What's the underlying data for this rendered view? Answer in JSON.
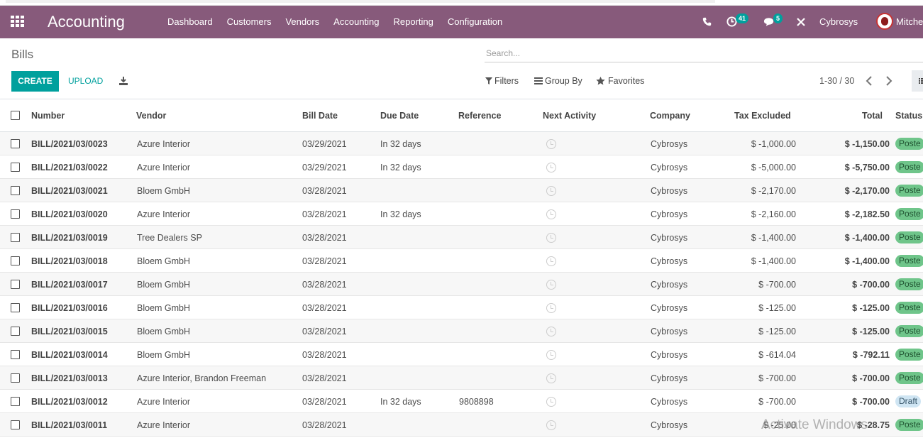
{
  "navbar": {
    "brand": "Accounting",
    "menu": [
      "Dashboard",
      "Customers",
      "Vendors",
      "Accounting",
      "Reporting",
      "Configuration"
    ],
    "activity_count": "41",
    "message_count": "5",
    "company": "Cybrosys",
    "user": "Mitche"
  },
  "page": {
    "title": "Bills",
    "search_placeholder": "Search...",
    "create_label": "CREATE",
    "upload_label": "UPLOAD",
    "filters_label": "Filters",
    "groupby_label": "Group By",
    "favorites_label": "Favorites",
    "pager": "1-30 / 30"
  },
  "table": {
    "columns": [
      "Number",
      "Vendor",
      "Bill Date",
      "Due Date",
      "Reference",
      "Next Activity",
      "Company",
      "Tax Excluded",
      "Total",
      "Status"
    ],
    "rows": [
      {
        "number": "BILL/2021/03/0023",
        "vendor": "Azure Interior",
        "bill_date": "03/29/2021",
        "due_date": "In 32 days",
        "reference": "",
        "company": "Cybrosys",
        "tax_excluded": "$ -1,000.00",
        "total": "$ -1,150.00",
        "status": "Poste",
        "status_type": "posted"
      },
      {
        "number": "BILL/2021/03/0022",
        "vendor": "Azure Interior",
        "bill_date": "03/29/2021",
        "due_date": "In 32 days",
        "reference": "",
        "company": "Cybrosys",
        "tax_excluded": "$ -5,000.00",
        "total": "$ -5,750.00",
        "status": "Poste",
        "status_type": "posted"
      },
      {
        "number": "BILL/2021/03/0021",
        "vendor": "Bloem GmbH",
        "bill_date": "03/28/2021",
        "due_date": "",
        "reference": "",
        "company": "Cybrosys",
        "tax_excluded": "$ -2,170.00",
        "total": "$ -2,170.00",
        "status": "Poste",
        "status_type": "posted"
      },
      {
        "number": "BILL/2021/03/0020",
        "vendor": "Azure Interior",
        "bill_date": "03/28/2021",
        "due_date": "In 32 days",
        "reference": "",
        "company": "Cybrosys",
        "tax_excluded": "$ -2,160.00",
        "total": "$ -2,182.50",
        "status": "Poste",
        "status_type": "posted"
      },
      {
        "number": "BILL/2021/03/0019",
        "vendor": "Tree Dealers SP",
        "bill_date": "03/28/2021",
        "due_date": "",
        "reference": "",
        "company": "Cybrosys",
        "tax_excluded": "$ -1,400.00",
        "total": "$ -1,400.00",
        "status": "Poste",
        "status_type": "posted"
      },
      {
        "number": "BILL/2021/03/0018",
        "vendor": "Bloem GmbH",
        "bill_date": "03/28/2021",
        "due_date": "",
        "reference": "",
        "company": "Cybrosys",
        "tax_excluded": "$ -1,400.00",
        "total": "$ -1,400.00",
        "status": "Poste",
        "status_type": "posted"
      },
      {
        "number": "BILL/2021/03/0017",
        "vendor": "Bloem GmbH",
        "bill_date": "03/28/2021",
        "due_date": "",
        "reference": "",
        "company": "Cybrosys",
        "tax_excluded": "$ -700.00",
        "total": "$ -700.00",
        "status": "Poste",
        "status_type": "posted"
      },
      {
        "number": "BILL/2021/03/0016",
        "vendor": "Bloem GmbH",
        "bill_date": "03/28/2021",
        "due_date": "",
        "reference": "",
        "company": "Cybrosys",
        "tax_excluded": "$ -125.00",
        "total": "$ -125.00",
        "status": "Poste",
        "status_type": "posted"
      },
      {
        "number": "BILL/2021/03/0015",
        "vendor": "Bloem GmbH",
        "bill_date": "03/28/2021",
        "due_date": "",
        "reference": "",
        "company": "Cybrosys",
        "tax_excluded": "$ -125.00",
        "total": "$ -125.00",
        "status": "Poste",
        "status_type": "posted"
      },
      {
        "number": "BILL/2021/03/0014",
        "vendor": "Bloem GmbH",
        "bill_date": "03/28/2021",
        "due_date": "",
        "reference": "",
        "company": "Cybrosys",
        "tax_excluded": "$ -614.04",
        "total": "$ -792.11",
        "status": "Poste",
        "status_type": "posted"
      },
      {
        "number": "BILL/2021/03/0013",
        "vendor": "Azure Interior, Brandon Freeman",
        "bill_date": "03/28/2021",
        "due_date": "",
        "reference": "",
        "company": "Cybrosys",
        "tax_excluded": "$ -700.00",
        "total": "$ -700.00",
        "status": "Poste",
        "status_type": "posted"
      },
      {
        "number": "BILL/2021/03/0012",
        "vendor": "Azure Interior",
        "bill_date": "03/28/2021",
        "due_date": "In 32 days",
        "reference": "9808898",
        "company": "Cybrosys",
        "tax_excluded": "$ -700.00",
        "total": "$ -700.00",
        "status": "Draft",
        "status_type": "draft"
      },
      {
        "number": "BILL/2021/03/0011",
        "vendor": "Azure Interior",
        "bill_date": "03/28/2021",
        "due_date": "",
        "reference": "",
        "company": "Cybrosys",
        "tax_excluded": "$ -25.00",
        "total": "$ -28.75",
        "status": "Poste",
        "status_type": "posted"
      }
    ]
  },
  "watermark": "Activate Windows",
  "colors": {
    "brand": "#875a7b",
    "primary": "#00a09d",
    "posted": "#6fc58a",
    "draft": "#cfe5f3"
  }
}
